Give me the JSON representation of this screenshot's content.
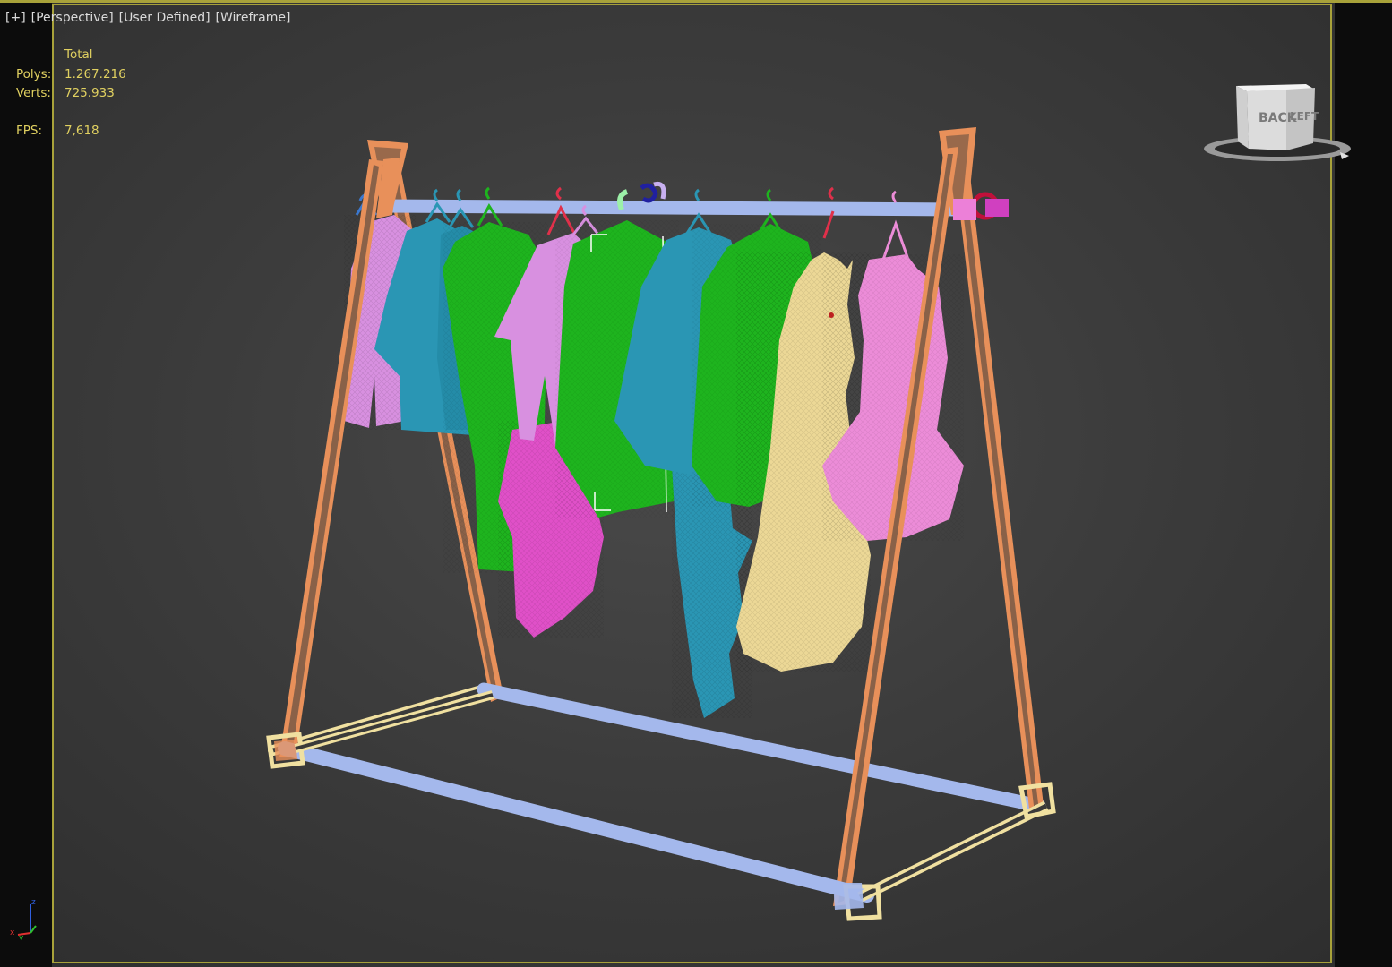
{
  "viewport": {
    "labels": [
      "[+]",
      "[Perspective]",
      "[User Defined]",
      "[Wireframe]"
    ]
  },
  "stats": {
    "header": "Total",
    "polys_label": "Polys:",
    "polys_value": "1.267.216",
    "verts_label": "Verts:",
    "verts_value": "725.933",
    "fps_label": "FPS:",
    "fps_value": "7,618"
  },
  "viewcube": {
    "face_back": "BACK",
    "face_left": "LEFT"
  },
  "axis_tripod": {
    "x": "x",
    "y": "y",
    "z": "z"
  },
  "colors": {
    "frame_orange": "#e8905a",
    "rail_blue": "#a4b8ec",
    "base_cream": "#f0e0a0",
    "garment_lilac": "#d890e0",
    "garment_teal": "#2a96b4",
    "garment_green": "#1eb41e",
    "garment_magenta": "#e050c8",
    "garment_yellow": "#ecd896",
    "garment_pink": "#ec8cd8",
    "stats_text": "#e0d060",
    "active_border": "#a8a23a"
  }
}
